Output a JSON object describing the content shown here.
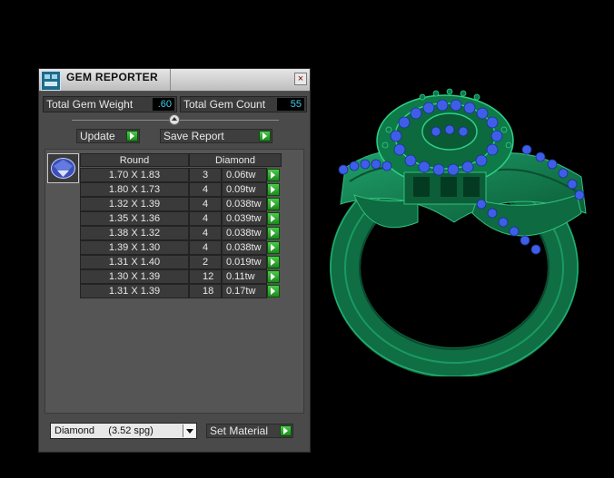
{
  "panel": {
    "title": "GEM REPORTER",
    "close_glyph": "×",
    "total_weight_label": "Total Gem Weight",
    "total_weight_value": ".60",
    "total_count_label": "Total Gem Count",
    "total_count_value": "55",
    "update_label": "Update",
    "save_report_label": "Save Report",
    "column_shape": "Round",
    "column_material": "Diamond",
    "rows": [
      {
        "size": "1.70 X 1.83",
        "count": "3",
        "weight": "0.06tw"
      },
      {
        "size": "1.80 X 1.73",
        "count": "4",
        "weight": "0.09tw"
      },
      {
        "size": "1.32 X 1.39",
        "count": "4",
        "weight": "0.038tw"
      },
      {
        "size": "1.35 X 1.36",
        "count": "4",
        "weight": "0.039tw"
      },
      {
        "size": "1.38 X 1.32",
        "count": "4",
        "weight": "0.038tw"
      },
      {
        "size": "1.39 X 1.30",
        "count": "4",
        "weight": "0.038tw"
      },
      {
        "size": "1.31 X 1.40",
        "count": "2",
        "weight": "0.019tw"
      },
      {
        "size": "1.30 X 1.39",
        "count": "12",
        "weight": "0.11tw"
      },
      {
        "size": "1.31 X 1.39",
        "count": "18",
        "weight": "0.17tw"
      }
    ],
    "material_select_value": "Diamond     (3.52 spg)",
    "set_material_label": "Set Material"
  },
  "icons": {
    "app": "gem-reporter-app-icon",
    "close": "close-icon",
    "arrow": "play-arrow-icon",
    "dropdown": "chevron-down-icon",
    "gem": "round-gem-icon"
  },
  "colors": {
    "panel_bg": "#4a4a4a",
    "value_text": "#3fd0f0",
    "arrow_green": "#2aa82a",
    "ring_green": "#0f7a4a",
    "gem_blue": "#3f5ee8"
  }
}
